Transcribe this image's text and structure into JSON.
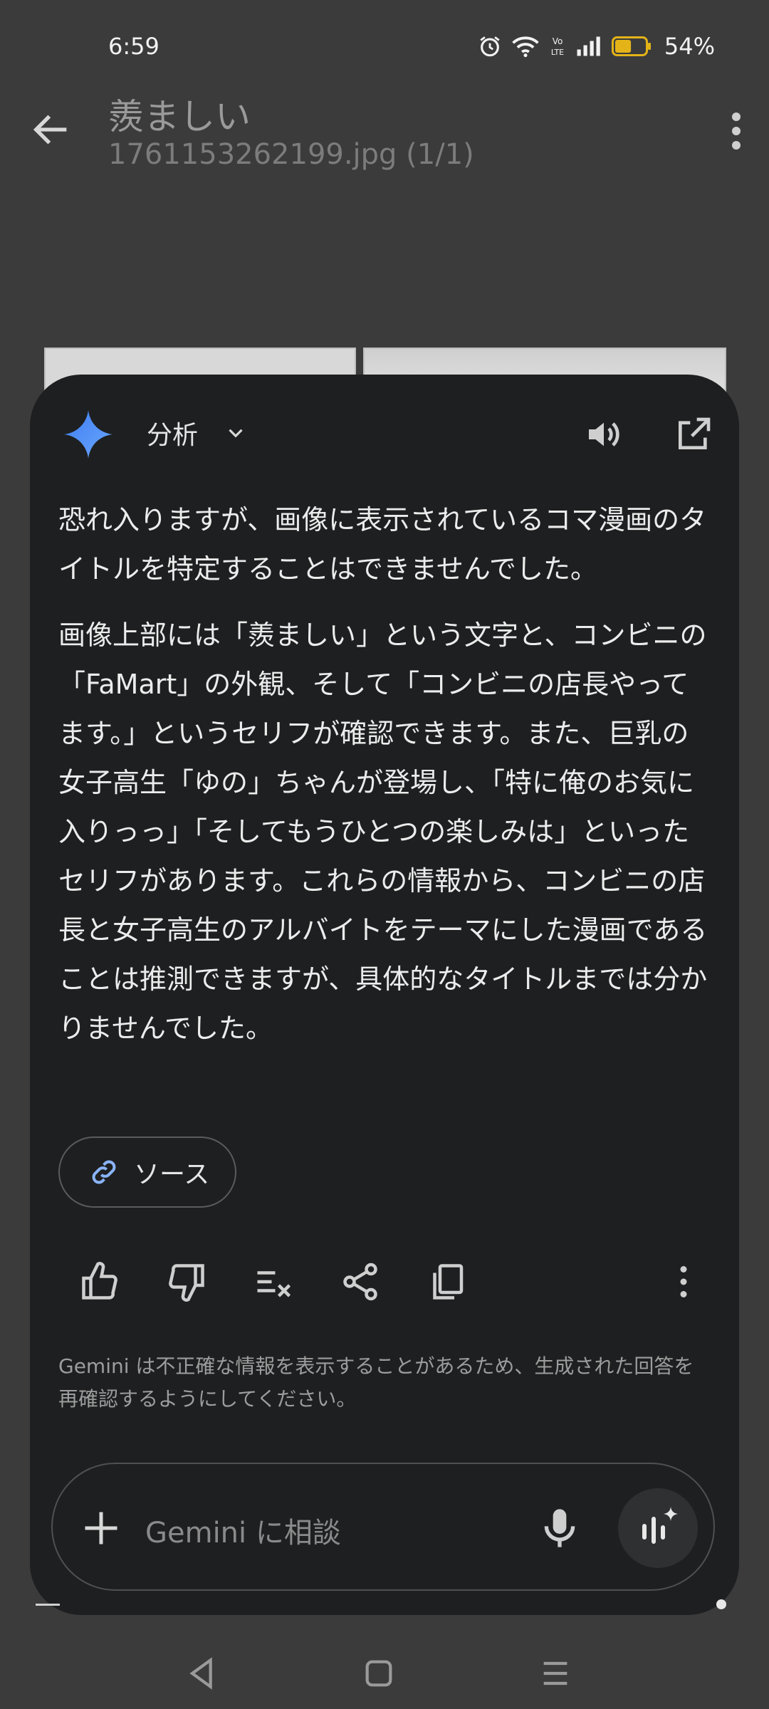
{
  "status_bar": {
    "time": "6:59",
    "battery_percent": "54%",
    "battery_level": 0.54,
    "network_label": "VoLTE"
  },
  "app_bar": {
    "title": "羨ましい",
    "subtitle": "1761153262199.jpg (1/1)"
  },
  "gemini": {
    "mode_label": "分析",
    "response_paragraphs": [
      "恐れ入りますが、画像に表示されているコマ漫画のタイトルを特定することはできませんでした。",
      "画像上部には「羨ましい」という文字と、コンビニの「FaMart」の外観、そして「コンビニの店長やってます。」というセリフが確認できます。また、巨乳の女子高生「ゆの」ちゃんが登場し、「特に俺のお気に入りっっ」「そしてもうひとつの楽しみは」といったセリフがあります。これらの情報から、コンビニの店長と女子高生のアルバイトをテーマにした漫画であることは推測できますが、具体的なタイトルまでは分かりませんでした。"
    ],
    "source_label": "ソース",
    "disclaimer": "Gemini は不正確な情報を表示することがあるため、生成された回答を再確認するようにしてください。",
    "input_placeholder": "Gemini に相談"
  },
  "icons": [
    "alarm-icon",
    "wifi-icon",
    "volte-icon",
    "signal-icon",
    "battery-icon",
    "back-arrow-icon",
    "more-vert-icon",
    "gemini-sparkle-icon",
    "chevron-down-icon",
    "speaker-icon",
    "open-external-icon",
    "link-icon",
    "thumb-up-icon",
    "thumb-down-icon",
    "double-check-icon",
    "share-icon",
    "copy-icon",
    "more-vert-icon",
    "plus-icon",
    "mic-icon",
    "gemini-live-icon",
    "nav-back-icon",
    "nav-home-icon",
    "nav-recents-icon"
  ],
  "colors": {
    "accent_blue": "#4f8cf7",
    "battery_fill": "#e3b318",
    "sheet_bg": "#1e1f20"
  }
}
